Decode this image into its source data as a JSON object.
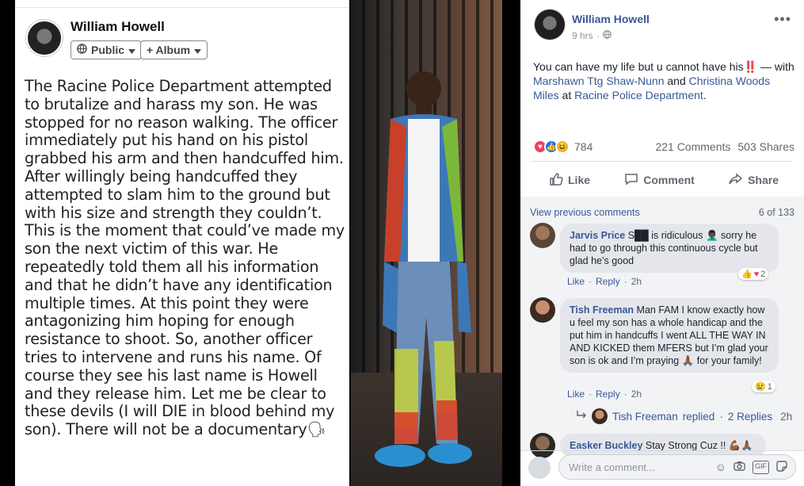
{
  "left_post": {
    "author": "William Howell",
    "audience_label": "Public",
    "album_label": "+ Album",
    "text": "The Racine Police Department attempted to brutalize and harass my son. He was stopped for no reason walking. The officer immediately put his hand on his pistol grabbed his arm and then handcuffed him. After willingly being handcuffed they attempted to slam him to the ground but with his size and strength they couldn’t. This is the moment that could’ve made my son the next victim of this war. He repeatedly told them all his information and that he didn’t have any identification multiple times. At this point they were antagonizing him hoping for enough resistance to shoot. So, another officer tries to intervene and runs his name. Of course they see his last name is Howell and they release him. Let me be clear to these devils (I will DIE in blood behind my son). There will not be a documentary🗣"
  },
  "post": {
    "author": "William Howell",
    "time": "9 hrs",
    "caption_prefix": "You can have my life but u cannot have his‼️ — with ",
    "tag1": "Marshawn Ttg Shaw-Nunn",
    "and_text": " and ",
    "tag2": "Christina Woods Miles",
    "at_text": " at ",
    "place": "Racine Police Department",
    "period": ".",
    "reaction_count": "784",
    "comments_count": "221 Comments",
    "shares_count": "503 Shares",
    "actions": {
      "like": "Like",
      "comment": "Comment",
      "share": "Share"
    }
  },
  "comments": {
    "view_previous": "View previous comments",
    "counter": "6 of 133",
    "items": [
      {
        "author": "Jarvis Price",
        "text": "S██ is ridiculous 🤦🏿‍♂️ sorry he had to go through this continuous cycle but glad he’s good",
        "like": "Like",
        "reply": "Reply",
        "time": "2h",
        "reactions": "2"
      },
      {
        "author": "Tish Freeman",
        "text": "Man FAM I know exactly how u feel my son has a whole handicap and the put him in handcuffs I went ALL THE WAY IN AND KICKED them MFERS but I’m glad your son is ok and I’m praying 🙏🏾 for your family!",
        "like": "Like",
        "reply": "Reply",
        "time": "2h",
        "reactions": "1"
      },
      {
        "author": "Easker Buckley",
        "text": "Stay Strong Cuz !! 💪🏾🙏🏾"
      }
    ],
    "reply_summary": {
      "author": "Tish Freeman",
      "verb": "replied",
      "sep": " · ",
      "replies": "2 Replies",
      "time": "2h"
    },
    "composer_placeholder": "Write a comment..."
  },
  "colors": {
    "fb_blue": "#385898",
    "bg_gray": "#f2f3f5",
    "like_blue": "#1877f2",
    "love_red": "#f33e58"
  }
}
